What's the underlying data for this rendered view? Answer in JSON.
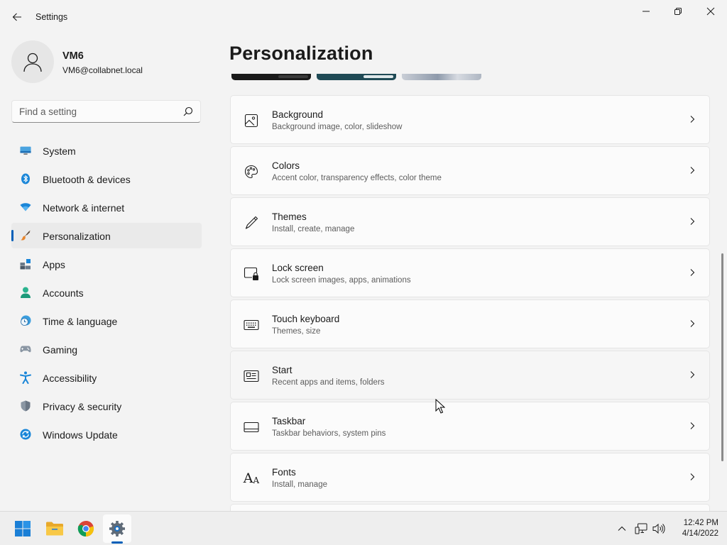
{
  "window": {
    "title": "Settings"
  },
  "profile": {
    "name": "VM6",
    "email": "VM6@collabnet.local"
  },
  "search": {
    "placeholder": "Find a setting",
    "value": ""
  },
  "nav": {
    "items": [
      {
        "label": "System",
        "icon": "system-icon"
      },
      {
        "label": "Bluetooth & devices",
        "icon": "bluetooth-icon"
      },
      {
        "label": "Network & internet",
        "icon": "wifi-icon"
      },
      {
        "label": "Personalization",
        "icon": "brush-icon",
        "active": true
      },
      {
        "label": "Apps",
        "icon": "apps-icon"
      },
      {
        "label": "Accounts",
        "icon": "accounts-icon"
      },
      {
        "label": "Time & language",
        "icon": "time-language-icon"
      },
      {
        "label": "Gaming",
        "icon": "gaming-icon"
      },
      {
        "label": "Accessibility",
        "icon": "accessibility-icon"
      },
      {
        "label": "Privacy & security",
        "icon": "shield-icon"
      },
      {
        "label": "Windows Update",
        "icon": "update-icon"
      }
    ]
  },
  "page": {
    "title": "Personalization"
  },
  "cards": [
    {
      "title": "Background",
      "subtitle": "Background image, color, slideshow",
      "icon": "image-icon"
    },
    {
      "title": "Colors",
      "subtitle": "Accent color, transparency effects, color theme",
      "icon": "palette-icon"
    },
    {
      "title": "Themes",
      "subtitle": "Install, create, manage",
      "icon": "pen-icon"
    },
    {
      "title": "Lock screen",
      "subtitle": "Lock screen images, apps, animations",
      "icon": "lock-screen-icon"
    },
    {
      "title": "Touch keyboard",
      "subtitle": "Themes, size",
      "icon": "keyboard-icon"
    },
    {
      "title": "Start",
      "subtitle": "Recent apps and items, folders",
      "icon": "start-icon"
    },
    {
      "title": "Taskbar",
      "subtitle": "Taskbar behaviors, system pins",
      "icon": "taskbar-icon"
    },
    {
      "title": "Fonts",
      "subtitle": "Install, manage",
      "icon": "fonts-icon"
    }
  ],
  "fonts_icon_text": "A",
  "taskbar": {
    "apps": [
      "start-icon",
      "file-explorer-icon",
      "chrome-icon",
      "settings-icon"
    ],
    "time": "12:42 PM",
    "date": "4/14/2022"
  },
  "colors": {
    "accent": "#005fb8",
    "background": "#f3f3f3",
    "card": "#fbfbfb"
  }
}
